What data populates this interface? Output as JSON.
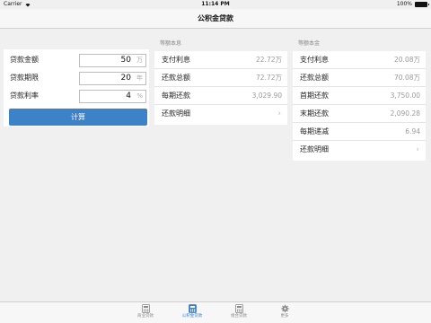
{
  "status_bar": {
    "carrier": "Carrier",
    "time": "11:14 PM",
    "battery": "100%"
  },
  "nav": {
    "title": "公积金贷款"
  },
  "form": {
    "rows": [
      {
        "label": "贷款金额",
        "value": "50",
        "unit": "万"
      },
      {
        "label": "贷款期限",
        "value": "20",
        "unit": "年"
      },
      {
        "label": "贷款利率",
        "value": "4",
        "unit": "%"
      }
    ],
    "calculate_label": "计算"
  },
  "equal_installment": {
    "title": "等额本息",
    "rows": [
      {
        "label": "支付利息",
        "value": "22.72万"
      },
      {
        "label": "还款总额",
        "value": "72.72万"
      },
      {
        "label": "每期还款",
        "value": "3,029.90"
      },
      {
        "label": "还款明细",
        "value": ""
      }
    ]
  },
  "equal_principal": {
    "title": "等额本金",
    "rows": [
      {
        "label": "支付利息",
        "value": "20.08万"
      },
      {
        "label": "还款总额",
        "value": "70.08万"
      },
      {
        "label": "首期还款",
        "value": "3,750.00"
      },
      {
        "label": "末期还款",
        "value": "2,090.28"
      },
      {
        "label": "每期递减",
        "value": "6.94"
      },
      {
        "label": "还款明细",
        "value": ""
      }
    ]
  },
  "tabs": [
    {
      "label": "商业贷款",
      "icon": "calculator-icon",
      "active": false
    },
    {
      "label": "公积金贷款",
      "icon": "calculator-icon",
      "active": true
    },
    {
      "label": "组合贷款",
      "icon": "calculator-icon",
      "active": false
    },
    {
      "label": "更多",
      "icon": "gear-icon",
      "active": false
    }
  ],
  "colors": {
    "accent": "#3c82c9",
    "background": "#f0f0f0",
    "muted_text": "#999999"
  }
}
